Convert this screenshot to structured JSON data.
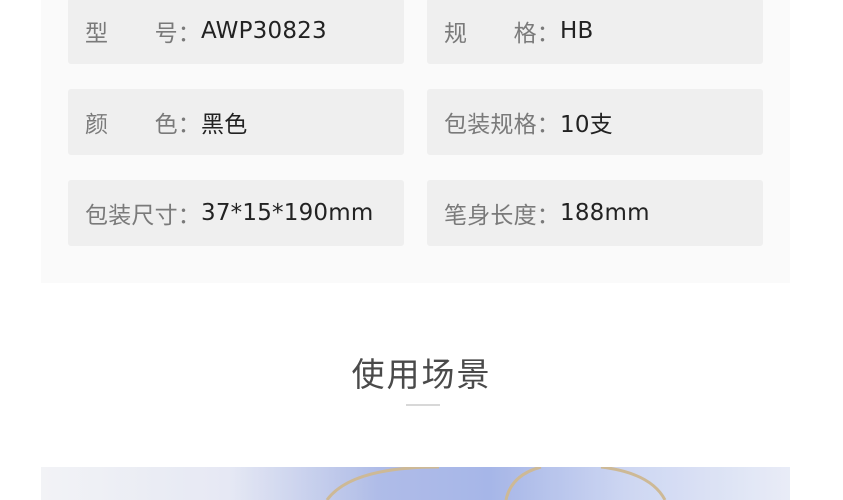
{
  "specs": [
    {
      "label": "型　　号：",
      "value": "AWP30823"
    },
    {
      "label": "规　　格：",
      "value": "HB"
    },
    {
      "label": "颜　　色：",
      "value": "黑色"
    },
    {
      "label": "包装规格：",
      "value": "10支"
    },
    {
      "label": "包装尺寸：",
      "value": "37*15*190mm"
    },
    {
      "label": "笔身长度：",
      "value": "188mm"
    }
  ],
  "section": {
    "title": "使用场景"
  },
  "colors": {
    "panel_bg": "#fafafa",
    "cell_bg": "#efefef",
    "label": "#7a7a7a",
    "value": "#222222",
    "title": "#4a4a4a"
  }
}
